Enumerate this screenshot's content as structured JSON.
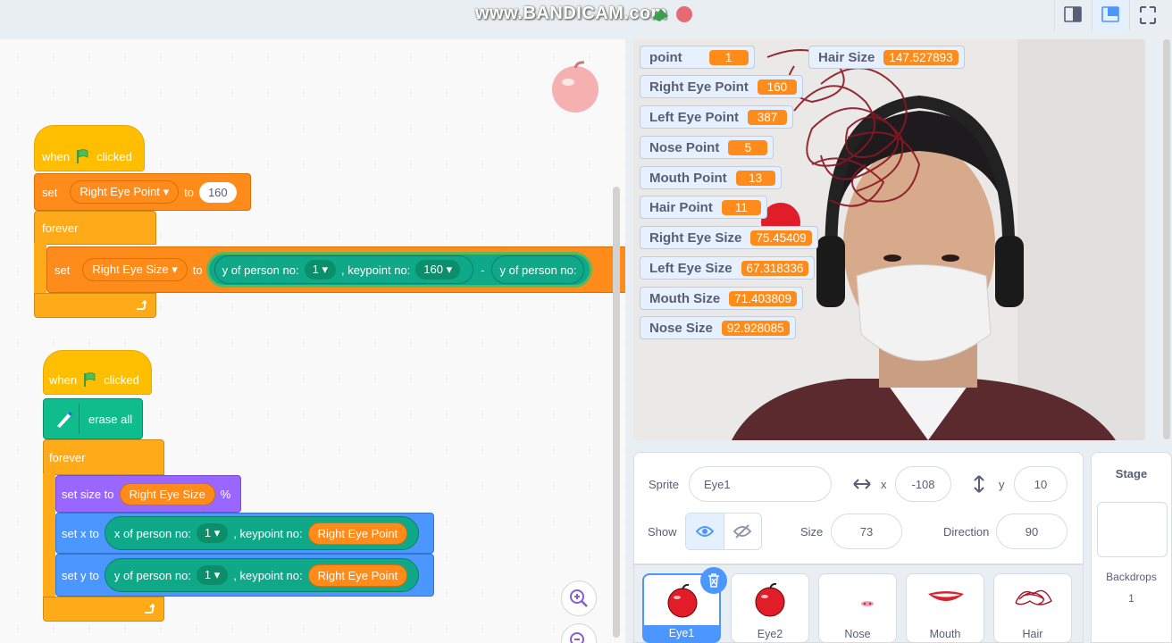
{
  "watermark": {
    "text": "www.BANDICAM.com"
  },
  "code": {
    "script1": {
      "hat_when": "when",
      "hat_clicked": "clicked",
      "set_label": "set",
      "set_var": "Right Eye Point",
      "set_to": "to",
      "set_value": "160",
      "forever": "forever",
      "set2_label": "set",
      "set2_var": "Right Eye Size",
      "set2_to": "to",
      "y_of_person": "y of person no:",
      "person_no": "1",
      "keypoint": ", keypoint no:",
      "keypoint_no": "160",
      "minus": "-",
      "y_of_person_2": "y of person no:"
    },
    "script2": {
      "hat_when": "when",
      "hat_clicked": "clicked",
      "erase_all": "erase all",
      "forever": "forever",
      "set_size_to": "set size to",
      "size_reporter": "Right Eye Size",
      "percent": "%",
      "set_x_to": "set x to",
      "x_of_person": "x of person no:",
      "person_no_1": "1",
      "keypoint_1": ", keypoint no:",
      "keypoint_rep_1": "Right Eye Point",
      "set_y_to": "set y to",
      "y_of_person": "y of person no:",
      "person_no_2": "1",
      "keypoint_2": ", keypoint no:",
      "keypoint_rep_2": "Right Eye Point"
    }
  },
  "monitors": [
    {
      "label": "point",
      "value": "1"
    },
    {
      "label": "Hair Size",
      "value": "147.527893"
    },
    {
      "label": "Right Eye Point",
      "value": "160"
    },
    {
      "label": "Left Eye Point",
      "value": "387"
    },
    {
      "label": "Nose Point",
      "value": "5"
    },
    {
      "label": "Mouth Point",
      "value": "13"
    },
    {
      "label": "Hair Point",
      "value": "11"
    },
    {
      "label": "Right Eye Size",
      "value": "75.45409"
    },
    {
      "label": "Left Eye Size",
      "value": "67.318336"
    },
    {
      "label": "Mouth Size",
      "value": "71.403809"
    },
    {
      "label": "Nose Size",
      "value": "92.928085"
    }
  ],
  "sprite_info": {
    "sprite_label": "Sprite",
    "sprite_name": "Eye1",
    "x_label": "x",
    "x_value": "-108",
    "y_label": "y",
    "y_value": "10",
    "show_label": "Show",
    "size_label": "Size",
    "size_value": "73",
    "direction_label": "Direction",
    "direction_value": "90"
  },
  "sprites": [
    "Eye1",
    "Eye2",
    "Nose",
    "Mouth",
    "Hair"
  ],
  "stage_panel": {
    "title": "Stage",
    "backdrops_label": "Backdrops",
    "backdrops_count": "1"
  },
  "colors": {
    "events": "#ffbf00",
    "variables": "#ff8c1a",
    "control": "#ffab19",
    "looks": "#9966ff",
    "motion": "#4c97ff",
    "pen": "#0fbd8c",
    "selected": "#4c97ff"
  }
}
